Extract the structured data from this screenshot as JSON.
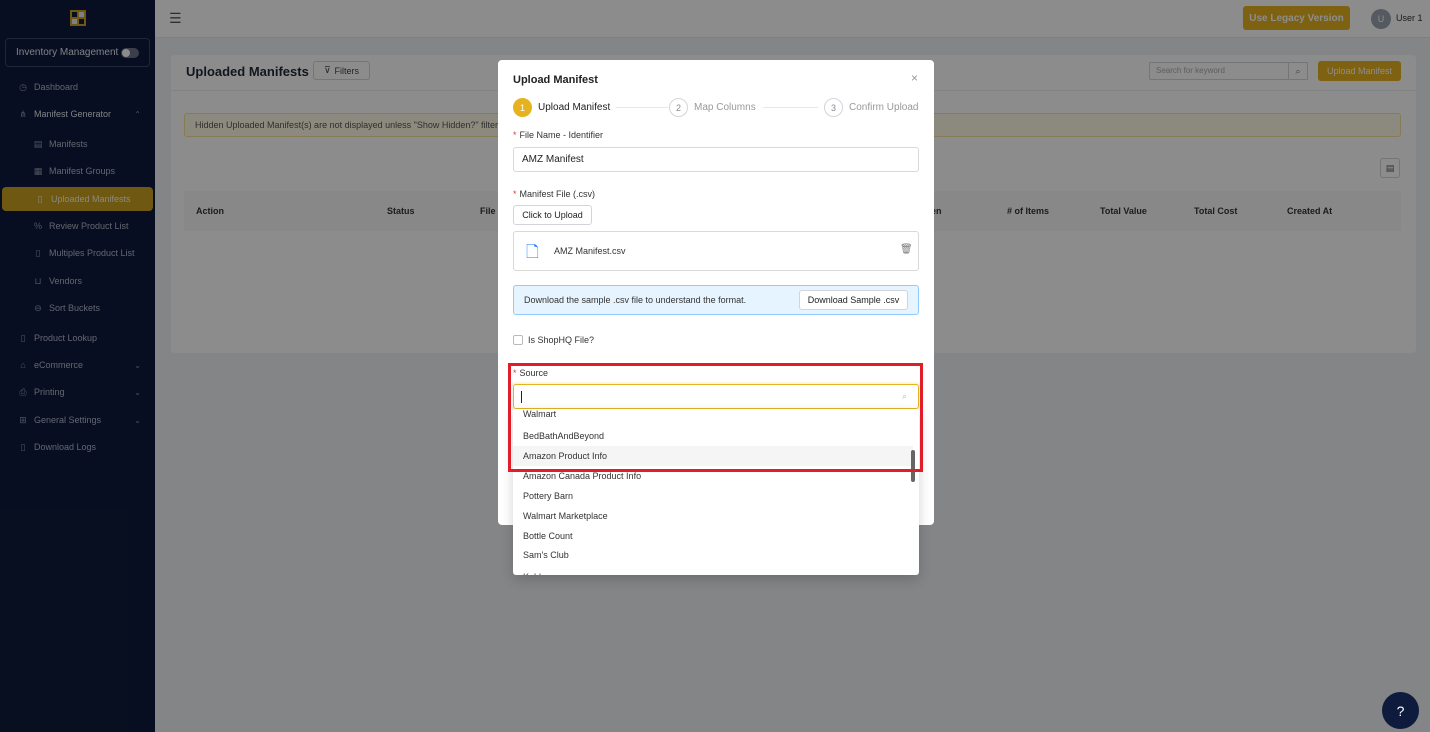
{
  "sidebar": {
    "inventory_label": "Inventory Management",
    "items": [
      {
        "label": "Dashboard",
        "icon": "dashboard-icon"
      },
      {
        "label": "Manifest Generator",
        "icon": "sitemap-icon"
      },
      {
        "label": "Manifests",
        "icon": "table-icon"
      },
      {
        "label": "Manifest Groups",
        "icon": "groups-icon"
      },
      {
        "label": "Uploaded Manifests",
        "icon": "file-icon"
      },
      {
        "label": "Review Product List",
        "icon": "percent-icon"
      },
      {
        "label": "Multiples Product List",
        "icon": "file-icon"
      },
      {
        "label": "Vendors",
        "icon": "cart-icon"
      },
      {
        "label": "Sort Buckets",
        "icon": "bucket-icon"
      },
      {
        "label": "Product Lookup",
        "icon": "file-icon"
      },
      {
        "label": "eCommerce",
        "icon": "shop-icon"
      },
      {
        "label": "Printing",
        "icon": "printer-icon"
      },
      {
        "label": "General Settings",
        "icon": "settings-icon"
      },
      {
        "label": "Download Logs",
        "icon": "file-icon"
      }
    ]
  },
  "topbar": {
    "legacy_label": "Use Legacy Version",
    "avatar_initial": "U",
    "user_name": "User 1"
  },
  "page": {
    "title": "Uploaded Manifests",
    "filters_label": "Filters",
    "search_placeholder": "Search for keyword",
    "upload_button": "Upload Manifest",
    "notice": "Hidden Uploaded Manifest(s) are not displayed unless \"Show Hidden?\" filter is",
    "columns": [
      "Action",
      "Status",
      "File I",
      "en",
      "# of Items",
      "Total Value",
      "Total Cost",
      "Created At"
    ]
  },
  "modal": {
    "title": "Upload Manifest",
    "steps": [
      {
        "num": "1",
        "label": "Upload Manifest"
      },
      {
        "num": "2",
        "label": "Map Columns"
      },
      {
        "num": "3",
        "label": "Confirm Upload"
      }
    ],
    "file_name_label": "File Name - Identifier",
    "file_name_value": "AMZ Manifest",
    "manifest_file_label": "Manifest File (.csv)",
    "click_upload": "Click to Upload",
    "uploaded_file": "AMZ Manifest.csv",
    "info_text": "Download the sample .csv file to understand the format.",
    "download_sample": "Download Sample .csv",
    "shophq_label": "Is ShopHQ File?",
    "source_label": "Source",
    "source_options": [
      "Walmart",
      "BedBathAndBeyond",
      "Amazon Product Info",
      "Amazon Canada Product Info",
      "Pottery Barn",
      "Walmart Marketplace",
      "Bottle Count",
      "Sam's Club",
      "Kohls"
    ],
    "highlighted_option": "Amazon Product Info"
  },
  "colors": {
    "sidebar": "#0f1b3d",
    "accent": "#e6b320",
    "highlight_border": "#e11d2a"
  }
}
